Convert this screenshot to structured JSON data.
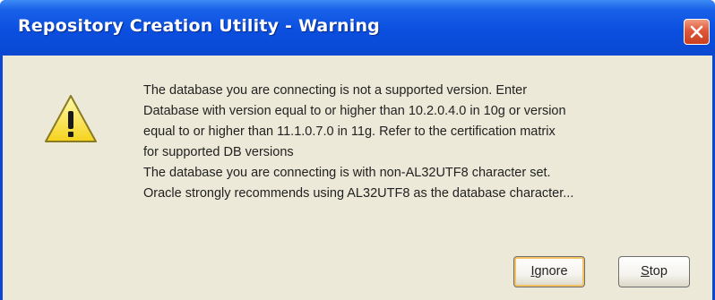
{
  "window": {
    "title": "Repository Creation Utility - Warning"
  },
  "icons": {
    "warning": "warning-icon",
    "close": "close-icon"
  },
  "message": {
    "lines": [
      "The database you are connecting is not a supported version.  Enter",
      "Database with version equal to or higher than 10.2.0.4.0 in 10g or version",
      "equal to or higher than 11.1.0.7.0 in 11g. Refer to the certification matrix",
      "for supported DB versions",
      "The database you are connecting is with non-AL32UTF8 character set.",
      "Oracle strongly recommends using AL32UTF8 as the database character..."
    ]
  },
  "buttons": {
    "ignore": {
      "mnemonic": "I",
      "rest": "gnore"
    },
    "stop": {
      "mnemonic": "S",
      "rest": "top"
    }
  },
  "colors": {
    "titlebar": "#0b4fe0",
    "dialog_background": "#ece9d8",
    "close_button": "#e0573a",
    "default_button_focus": "#f2c263"
  }
}
